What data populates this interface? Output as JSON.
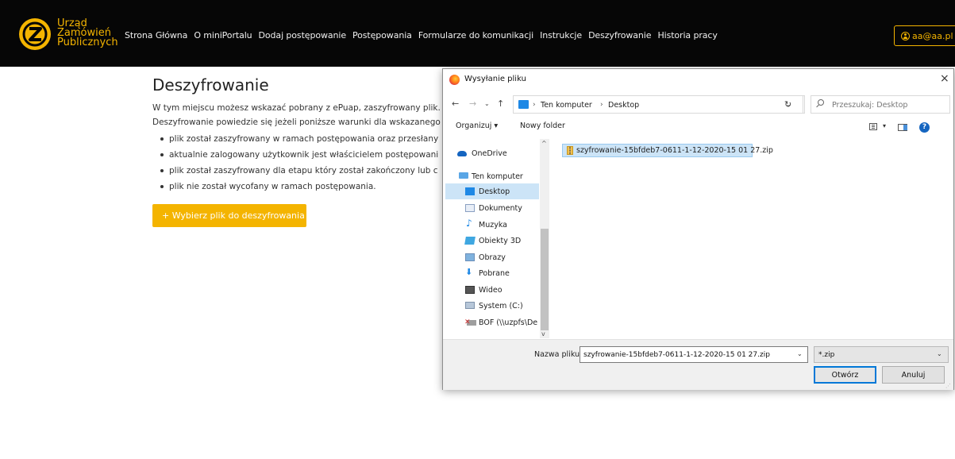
{
  "brand": {
    "line1": "Urząd",
    "line2": "Zamówień",
    "line3": "Publicznych",
    "color": "#f4b400"
  },
  "nav": {
    "items": [
      "Strona Główna",
      "O miniPortalu",
      "Dodaj postępowanie",
      "Postępowania",
      "Formularze do komunikacji",
      "Instrukcje",
      "Deszyfrowanie",
      "Historia pracy"
    ],
    "user": "aa@aa.pl"
  },
  "page": {
    "title": "Deszyfrowanie",
    "intro_line1": "W tym miejscu możesz wskazać pobrany z ePuap, zaszyfrowany plik.",
    "intro_line2": "Deszyfrowanie powiedzie się jeżeli poniższe warunki dla wskazanego p",
    "conditions": [
      "plik został zaszyfrowany w ramach postępowania oraz przesłany",
      "aktualnie zalogowany użytkownik jest właścicielem postępowani",
      "plik został zaszyfrowany dla etapu który został zakończony lub c",
      "plik nie został wycofany w ramach postępowania."
    ],
    "choose_button": "+ Wybierz plik do deszyfrowania"
  },
  "dialog": {
    "title": "Wysyłanie pliku",
    "close": "×",
    "breadcrumb": [
      "Ten komputer",
      "Desktop"
    ],
    "search_placeholder": "Przeszukaj: Desktop",
    "toolbar": {
      "organize": "Organizuj ▾",
      "new_folder": "Nowy folder"
    },
    "nav_pane": [
      {
        "label": "OneDrive",
        "icon": "onedrive-icon"
      },
      {
        "label": "Ten komputer",
        "icon": "computer-icon"
      },
      {
        "label": "Desktop",
        "icon": "desktop-icon",
        "selected": true
      },
      {
        "label": "Dokumenty",
        "icon": "documents-icon"
      },
      {
        "label": "Muzyka",
        "icon": "music-icon"
      },
      {
        "label": "Obiekty 3D",
        "icon": "objects-3d-icon"
      },
      {
        "label": "Obrazy",
        "icon": "pictures-icon"
      },
      {
        "label": "Pobrane",
        "icon": "downloads-icon"
      },
      {
        "label": "Wideo",
        "icon": "video-icon"
      },
      {
        "label": "System (C:)",
        "icon": "drive-icon"
      },
      {
        "label": "BOF (\\\\uzpfs\\De",
        "icon": "network-drive-icon"
      }
    ],
    "files": [
      "szyfrowanie-15bfdeb7-0611-1-12-2020-15 01 27.zip"
    ],
    "file_name_label": "Nazwa pliku:",
    "file_name_value": "szyfrowanie-15bfdeb7-0611-1-12-2020-15 01 27.zip",
    "filter": "*.zip",
    "open_button": "Otwórz",
    "cancel_button": "Anuluj"
  }
}
